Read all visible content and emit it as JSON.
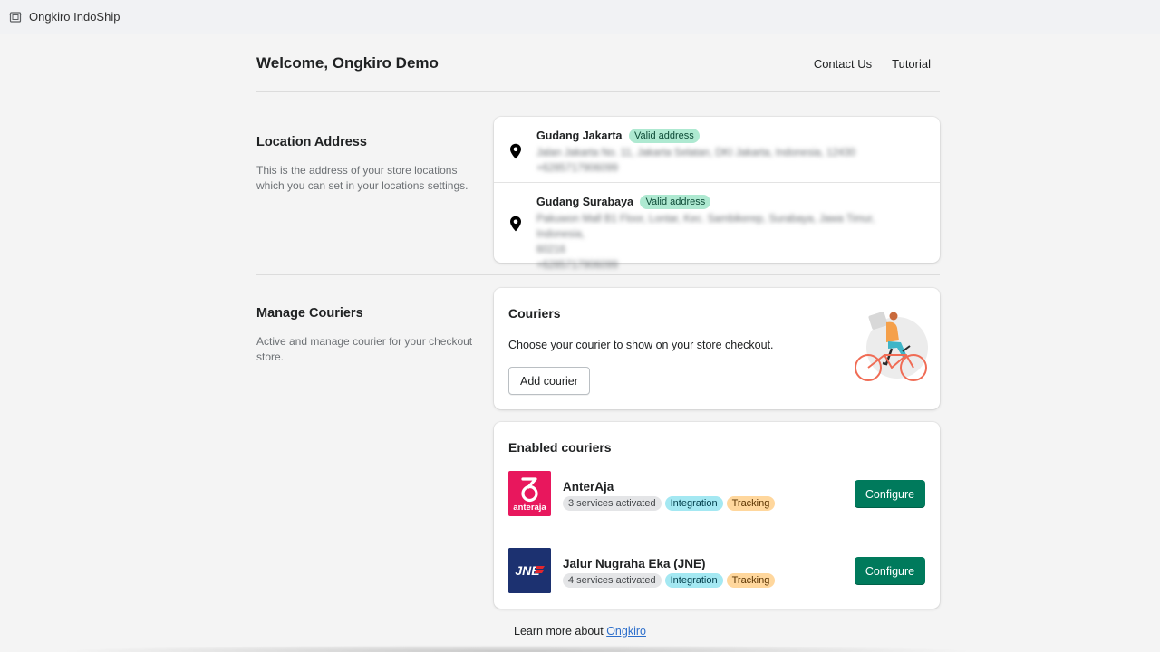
{
  "topbar": {
    "app_title": "Ongkiro IndoShip",
    "icon": "app-frame-icon"
  },
  "header": {
    "title": "Welcome, Ongkiro Demo",
    "links": [
      "Contact Us",
      "Tutorial"
    ]
  },
  "location_section": {
    "title": "Location Address",
    "description": "This is the address of your store locations which you can set in your locations settings.",
    "locations": [
      {
        "name": "Gudang Jakarta",
        "badge": "Valid address",
        "address_lines": [
          "Jalan Jakarta No. 11, Jakarta Selatan, DKI Jakarta, Indonesia, 12430"
        ],
        "phone": "+6285717906099"
      },
      {
        "name": "Gudang Surabaya",
        "badge": "Valid address",
        "address_lines": [
          "Pakuwon Mall B1 Floor, Lontar, Kec. Sambikerep, Surabaya, Jawa Timur, Indonesia,",
          "60216"
        ],
        "phone": "+6285717906099"
      }
    ]
  },
  "couriers_section": {
    "title": "Manage Couriers",
    "description": "Active and manage courier for your checkout store.",
    "card": {
      "title": "Couriers",
      "description": "Choose your courier to show on your store checkout.",
      "button": "Add courier"
    },
    "enabled": {
      "title": "Enabled couriers",
      "items": [
        {
          "name": "AnterAja",
          "logo_text": "anteraja",
          "services": "3 services activated",
          "badges": [
            "Integration",
            "Tracking"
          ],
          "button": "Configure"
        },
        {
          "name": "Jalur Nugraha Eka (JNE)",
          "logo_text": "JNE",
          "services": "4 services activated",
          "badges": [
            "Integration",
            "Tracking"
          ],
          "button": "Configure"
        }
      ]
    }
  },
  "footer": {
    "text": "Learn more about",
    "link": "Ongkiro"
  },
  "colors": {
    "primary": "#007a5c",
    "badge_valid": "#aee9d1",
    "badge_integration": "#a4e8f2",
    "badge_tracking": "#ffd79d",
    "anteraja_brand": "#e8175d",
    "jne_brand": "#1c3170"
  }
}
